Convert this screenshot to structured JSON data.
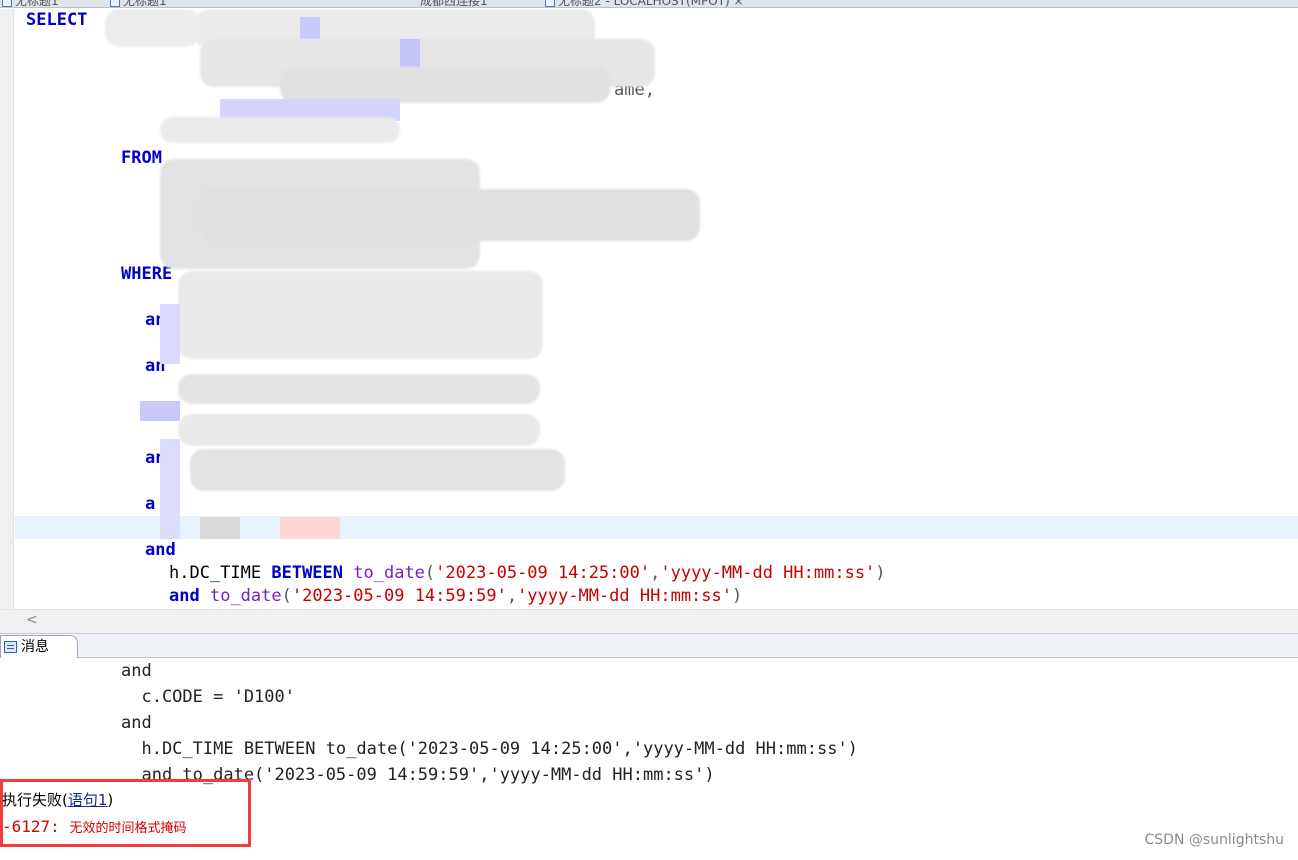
{
  "tabs": [
    {
      "label": "无标题1"
    },
    {
      "label": "无标题1"
    },
    {
      "label": "成都西连接1"
    },
    {
      "label": "无标题2 - LOCALHOST(MPOT) ×"
    }
  ],
  "editor": {
    "kw_select": "SELECT",
    "kw_from": "FROM",
    "kw_where": "WHERE",
    "and_fragment": "an",
    "and_fragment2": "a",
    "partial_text": "ame,",
    "and_full": "and",
    "line_between_prefix": "h.DC_TIME ",
    "kw_between": "BETWEEN",
    "fn_to_date": "to_date",
    "paren_open": "(",
    "comma": ",",
    "paren_close": ")",
    "date_start": "'2023-05-09 14:25:00'",
    "date_end": "'2023-05-09 14:59:59'",
    "fmt": "'yyyy-MM-dd HH:mm:ss'",
    "kw_and": "and"
  },
  "scrollbar": {
    "left_arrow": "<"
  },
  "messages": {
    "tab_label": "消息",
    "lines": [
      "and",
      "  c.CODE = 'D100'",
      "and",
      "  h.DC_TIME BETWEEN to_date('2023-05-09 14:25:00','yyyy-MM-dd HH:mm:ss')",
      "  and to_date('2023-05-09 14:59:59','yyyy-MM-dd HH:mm:ss')"
    ],
    "error_title": "执行失败(",
    "error_link": "语句1",
    "error_title_end": ")",
    "error_code": "-6127: ",
    "error_message": "无效的时间格式掩码"
  },
  "watermark": "CSDN @sunlightshu",
  "colors": {
    "keyword": "#0000c8",
    "string": "#c80000",
    "error": "#d40000",
    "highlight_box": "#f23b3b"
  }
}
